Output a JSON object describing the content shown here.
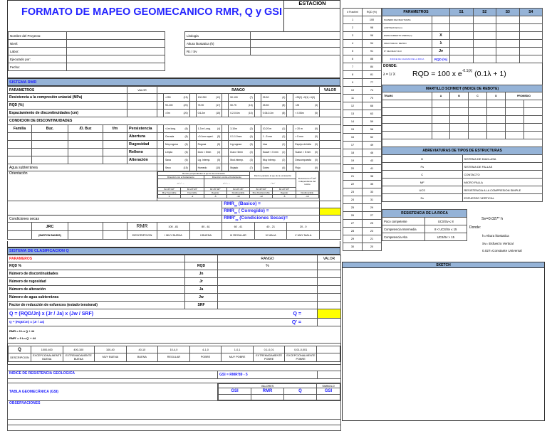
{
  "title": "FORMATO DE MAPEO GEOMECANICO RMR, Q y GSI",
  "estacion": "ESTACION",
  "project_fields": [
    "Nombre del Proyecto:",
    "Nivel:",
    "Labor:",
    "Ejecutado por:",
    "Fecha:"
  ],
  "litho_fields": [
    "Litologia",
    "Altura litostatica (h)",
    "Rc / Sv"
  ],
  "rmr": {
    "section": "SISTEMA RMR",
    "h_param": "PARAMETROS",
    "h_valor": "VALOR",
    "h_rango": "RANGO",
    "h_valor2": "VALOR",
    "rows": [
      {
        "label": "Resistencia a la compresión uniaxial (MPa)",
        "ranges": [
          [
            ">250",
            "(15)"
          ],
          [
            "100-250",
            "(12)"
          ],
          [
            "50-100",
            "(7)"
          ],
          [
            "25-50",
            "(4)"
          ],
          [
            "<25(2) <5(1) <1(0)",
            ""
          ]
        ]
      },
      {
        "label": "RQD (%)",
        "ranges": [
          [
            "90-100",
            "(20)"
          ],
          [
            "75-90",
            "(17)"
          ],
          [
            "50-75",
            "(13)"
          ],
          [
            "25-50",
            "(8)"
          ],
          [
            "<25",
            "(3)"
          ]
        ]
      },
      {
        "label": "Espaciamiento de discontinuidades (cm)",
        "ranges": [
          [
            ">2m",
            "(20)"
          ],
          [
            "0.6-2m",
            "(15)"
          ],
          [
            "0.2-0.6m",
            "(10)"
          ],
          [
            "0.06-0.2m",
            "(8)"
          ],
          [
            "< 0.06m",
            "(5)"
          ]
        ]
      }
    ],
    "cond_title": "CONDICION DE DISCONTINUIDADES",
    "cond_heads": [
      "Familia",
      "Buz.",
      "/D. Buz",
      "f/m"
    ],
    "cond_rows": [
      {
        "label": "Persistencia",
        "ranges": [
          [
            "<1m long.",
            "(6)"
          ],
          [
            "1-3 m Long.",
            "(4)"
          ],
          [
            "3-10m",
            "(2)"
          ],
          [
            "10-20 m",
            "(1)"
          ],
          [
            "> 20 m",
            "(0)"
          ]
        ]
      },
      {
        "label": "Abertura",
        "ranges": [
          [
            "Cerrada",
            "(6)"
          ],
          [
            "<0.1mm apert.",
            "(5)"
          ],
          [
            "0.1-1.0mm",
            "(4)"
          ],
          [
            "1 - 5 mm",
            "(1)"
          ],
          [
            "> 5 mm",
            "(0)"
          ]
        ]
      },
      {
        "label": "Rugosidad",
        "ranges": [
          [
            "Muy rugosa",
            "(6)"
          ],
          [
            "Rugosa",
            "(5)"
          ],
          [
            "Lig.rugosa",
            "(3)"
          ],
          [
            "Lisa",
            "(1)"
          ],
          [
            "Espejo de falla",
            "(0)"
          ]
        ]
      },
      {
        "label": "Relleno",
        "ranges": [
          [
            "Limpia",
            "(6)"
          ],
          [
            "Duro < 5mm",
            "(4)"
          ],
          [
            "Duro> 5mm",
            "(2)"
          ],
          [
            "Suave < 5 mm",
            "(1)"
          ],
          [
            "Suave > 5 mm",
            "(0)"
          ]
        ]
      },
      {
        "label": "Alteración",
        "ranges": [
          [
            "Sana",
            "(6)"
          ],
          [
            "Lig. Intemp.",
            "(5)"
          ],
          [
            "Mod.Intemp.",
            "(3)"
          ],
          [
            "Muy Intemp.",
            "(2)"
          ],
          [
            "Descompuesta",
            "(0)"
          ]
        ]
      }
    ],
    "agua": {
      "label": "Agua subterránea",
      "ranges": [
        [
          "Seco",
          "(15)"
        ],
        [
          "Humedo",
          "(10)"
        ],
        [
          "Mojado",
          "(7)"
        ],
        [
          "Goteo",
          "(4)"
        ],
        [
          "Flujo",
          "(0)"
        ]
      ]
    },
    "orient": {
      "label": "Orientación",
      "perp": "Rumbo perpendicular al eje de la excavación",
      "con": "Dirección con el buzamiento",
      "contra": "Dirección contra el buzamiento",
      "par": "Rumbo paralelo al eje de la excavación",
      "ind": "Buzamiento 0º-20º independiente del rumbo",
      "cols": [
        [
          "Bz 45º-90º",
          "Muy Favorable",
          "0"
        ],
        [
          "Bz 20º-45º",
          "Favorable",
          "-2"
        ],
        [
          "Bz 45º-90º",
          "Regular",
          "-5"
        ],
        [
          "Bz 20º-45º",
          "Desfavorable",
          "-10"
        ],
        [
          "Bz 45º-90º",
          "Muy Desfavorable",
          "-12"
        ],
        [
          "Bz 20º-45º",
          "Regular",
          "-5"
        ],
        [
          "",
          "Desfavorable",
          "-10"
        ]
      ]
    },
    "basico": "RMR89 (Basico) =",
    "corregido": "RMR89 ( Corregido) =",
    "secas": "RMR'89 (Condiciones Secas)=",
    "cond_secas": "Condiciones secas",
    "jrc": "JRC",
    "jrc_sub": "(BARTON BANDIS)",
    "class_head": "RMR",
    "class_desc": "DESCRIPCION",
    "classes": [
      [
        "100 - 81",
        "I  MUY BUENA"
      ],
      [
        "80 - 61",
        "II BUENA"
      ],
      [
        "60 - 41",
        "III  REGULAR"
      ],
      [
        "40 - 21",
        "IV  MALA"
      ],
      [
        "20 - 0",
        "V  MUY MALA"
      ]
    ]
  },
  "q": {
    "section": "SISTEMA DE CLASIFICACION Q",
    "h_param": "PARAMEROS",
    "h_rango": "RANGO",
    "h_valor": "VALOR",
    "rows": [
      [
        "RQD %",
        "RQD",
        "%"
      ],
      [
        "Número de discontinuidades",
        "Jn",
        ""
      ],
      [
        "Número de rugosidad",
        "Jr",
        ""
      ],
      [
        "Número de alteración",
        "Ja",
        ""
      ],
      [
        "Número de agua subterránea",
        "Jw",
        ""
      ],
      [
        "Factor de reducción de esfuerzos (estado tensional)",
        "SRF",
        ""
      ]
    ],
    "formula": "Q = (RQD/Jn) x (Jr / Ja) x (Jw / SRF)",
    "q_eq": "Q  =",
    "formula2": "Q = (RQD/Jn) x (Jr / Ja)",
    "q2_eq": "Q'  =",
    "rmr_q": "RMR = 9 Ln Q + 44",
    "rmr_q2": "RMR' = 9 Ln Q' + 44",
    "class_head": "Q",
    "class_desc": "DESCRIPCION",
    "classes": [
      [
        "1000-400",
        "EXCEPCIONALMENTE BUENA"
      ],
      [
        "400-100",
        "EXTREMADAMENTE BUENA"
      ],
      [
        "100-40",
        "MUY BUENA"
      ],
      [
        "40-10",
        "BUENA"
      ],
      [
        "10-4,0",
        "REGULAR"
      ],
      [
        "4-1,0",
        "POBRE"
      ],
      [
        "1-0,1",
        "MUY POBRE"
      ],
      [
        "0,1-0,01",
        "EXTREMADAMENTE POBRE"
      ],
      [
        "0,01-0,001",
        "EXCEPCIONALMENTE POBRE"
      ]
    ]
  },
  "gsi": {
    "title": "INDICE DE RESISTENCIA GEOLÓGICA",
    "formula": "GSI = RMR'89 - 5",
    "tabla": "TABLA GEOMECÁNICA (GSI)",
    "valores": "VALORES",
    "simbolo": "SIMBOLO",
    "cols": [
      "GSI",
      "RMR",
      "Q"
    ],
    "sym": "GSI"
  },
  "observaciones": "OBSERVACIONES",
  "rqd_table": {
    "h1": "# Fract/ml",
    "h2": "RQD (%)",
    "rows": [
      [
        1,
        100
      ],
      [
        2,
        98
      ],
      [
        3,
        96
      ],
      [
        4,
        94
      ],
      [
        5,
        91
      ],
      [
        6,
        88
      ],
      [
        7,
        84
      ],
      [
        8,
        81
      ],
      [
        9,
        77
      ],
      [
        10,
        74
      ],
      [
        11,
        70
      ],
      [
        12,
        66
      ],
      [
        13,
        63
      ],
      [
        14,
        59
      ],
      [
        15,
        56
      ],
      [
        16,
        52
      ],
      [
        17,
        49
      ],
      [
        18,
        46
      ],
      [
        19,
        43
      ],
      [
        20,
        41
      ],
      [
        21,
        38
      ],
      [
        22,
        35
      ],
      [
        23,
        33
      ],
      [
        24,
        31
      ],
      [
        25,
        29
      ],
      [
        26,
        27
      ],
      [
        27,
        25
      ],
      [
        28,
        23
      ],
      [
        29,
        21
      ],
      [
        30,
        20
      ]
    ]
  },
  "params": {
    "head": "PARAMETROS",
    "cols": [
      "S1",
      "S2",
      "S3",
      "S4"
    ],
    "rows": [
      [
        "NUMERO DE FRACTURAS",
        ""
      ],
      [
        "LONTIGUD EN (m)",
        ""
      ],
      [
        "ESPACIAMIENTO MEDIO(m)",
        "X"
      ],
      [
        "FRACTURAS / METRO",
        "λ"
      ],
      [
        "N° DE FRACT./m3",
        "Jv"
      ],
      [
        "INDICE DE CALIDAD DE LA ROCA",
        "RQD (%)"
      ]
    ],
    "donde": "DONDE:",
    "lambda": "λ = 1/ X",
    "formula": "RQD = 100 x e",
    "exp": "-0.1(λ)",
    "formula_tail": " (0.1λ + 1)"
  },
  "schmidt": {
    "title": "MARTILLO SCHMIDT (INDICE DE REBOTE)",
    "cols": [
      "TRAMO",
      "A",
      "B",
      "C",
      "D",
      "PROMEDIO"
    ]
  },
  "abrev": {
    "title": "ABREVIATURAS DE TIPOS DE ESTRUCTURAS",
    "rows": [
      [
        "D",
        "SISTEMA DE DIACLASA"
      ],
      [
        "Fs",
        "SISTEMA DE FALLAS"
      ],
      [
        "C",
        "CONTACTO"
      ],
      [
        "MF",
        "MICRO FALLA"
      ],
      [
        "UCS",
        "RESISTENCIA A LA COMPRESION SIMPLE"
      ],
      [
        "Sv",
        "ESFUERZO VERTICAL"
      ]
    ]
  },
  "roca": {
    "title": "RESISTENCIA DE LA ROCA",
    "rows": [
      [
        "Poco competente",
        "UCS/Sv ≤ 8"
      ],
      [
        "Competencia Intermedia",
        "8 < UCS/Sv ≤ 15"
      ],
      [
        "Competencia Alta",
        "UCS/Sv > 15"
      ]
    ],
    "sv": "Sv=0.027* h",
    "donde": "Donde:",
    "notes": [
      "h=Altura litostatica",
      "Sv= Esfuerzo Vertical",
      "0.027=Constante Universal"
    ]
  },
  "sketch": "SKETCH",
  "colors": {
    "accent": "#2323ff",
    "header": "#95b3d7",
    "highlight": "#ffff00"
  }
}
